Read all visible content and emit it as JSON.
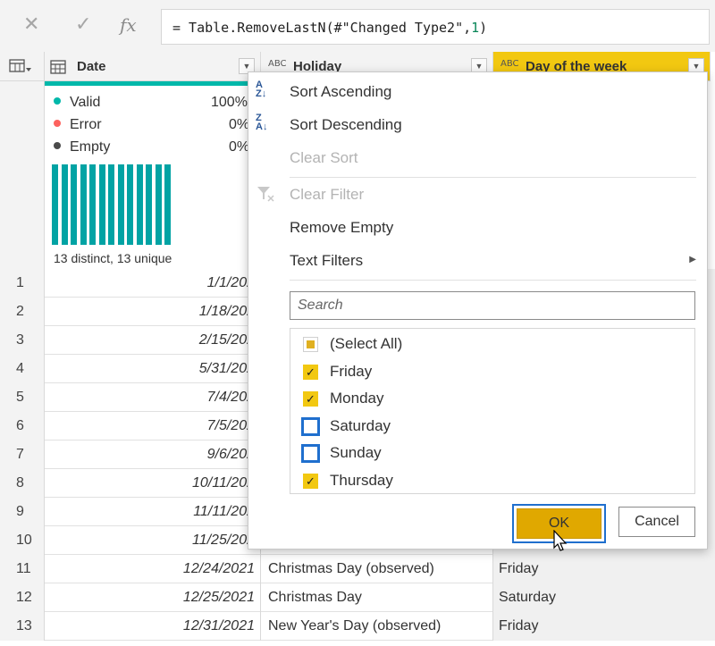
{
  "formula_bar": {
    "cancel_icon": "close-icon",
    "commit_icon": "check-icon",
    "fx_label": "fx",
    "formula_prefix": "= Table.RemoveLastN(#\"Changed Type2\",",
    "formula_num": "1",
    "formula_suffix": ")"
  },
  "columns": {
    "date": {
      "label": "Date",
      "type_icon": "calendar-icon"
    },
    "holiday": {
      "label": "Holiday",
      "type_icon": "ABC"
    },
    "dow": {
      "label": "Day of the week",
      "type_icon": "ABC"
    }
  },
  "profile": {
    "valid_label": "Valid",
    "valid_pct": "100%",
    "valid_color": "#01b8aa",
    "error_label": "Error",
    "error_pct": "0%",
    "error_color": "#fd625e",
    "empty_label": "Empty",
    "empty_pct": "0%",
    "empty_color": "#4a4a4a",
    "distinct_text": "13 distinct, 13 unique",
    "bar_count": 13
  },
  "rows": [
    {
      "num": "1",
      "date": "1/1/202",
      "holiday": "",
      "dow": ""
    },
    {
      "num": "2",
      "date": "1/18/202",
      "holiday": "",
      "dow": ""
    },
    {
      "num": "3",
      "date": "2/15/202",
      "holiday": "",
      "dow": ""
    },
    {
      "num": "4",
      "date": "5/31/202",
      "holiday": "",
      "dow": ""
    },
    {
      "num": "5",
      "date": "7/4/202",
      "holiday": "",
      "dow": ""
    },
    {
      "num": "6",
      "date": "7/5/202",
      "holiday": "",
      "dow": ""
    },
    {
      "num": "7",
      "date": "9/6/202",
      "holiday": "",
      "dow": ""
    },
    {
      "num": "8",
      "date": "10/11/202",
      "holiday": "",
      "dow": ""
    },
    {
      "num": "9",
      "date": "11/11/202",
      "holiday": "",
      "dow": ""
    },
    {
      "num": "10",
      "date": "11/25/202",
      "holiday": "",
      "dow": ""
    },
    {
      "num": "11",
      "date": "12/24/2021",
      "holiday": "Christmas Day (observed)",
      "dow": "Friday"
    },
    {
      "num": "12",
      "date": "12/25/2021",
      "holiday": "Christmas Day",
      "dow": "Saturday"
    },
    {
      "num": "13",
      "date": "12/31/2021",
      "holiday": "New Year's Day (observed)",
      "dow": "Friday"
    }
  ],
  "menu": {
    "sort_asc": "Sort Ascending",
    "sort_desc": "Sort Descending",
    "clear_sort": "Clear Sort",
    "clear_filter": "Clear Filter",
    "remove_empty": "Remove Empty",
    "text_filters": "Text Filters",
    "search_placeholder": "Search",
    "values": [
      {
        "label": "(Select All)",
        "state": "partial"
      },
      {
        "label": "Friday",
        "state": "checked"
      },
      {
        "label": "Monday",
        "state": "checked"
      },
      {
        "label": "Saturday",
        "state": "unchecked"
      },
      {
        "label": "Sunday",
        "state": "unchecked"
      },
      {
        "label": "Thursday",
        "state": "checked"
      }
    ],
    "ok_label": "OK",
    "cancel_label": "Cancel"
  },
  "colors": {
    "accent_yellow": "#f2c811",
    "teal": "#01b8aa",
    "focus_blue": "#1f6fce"
  }
}
